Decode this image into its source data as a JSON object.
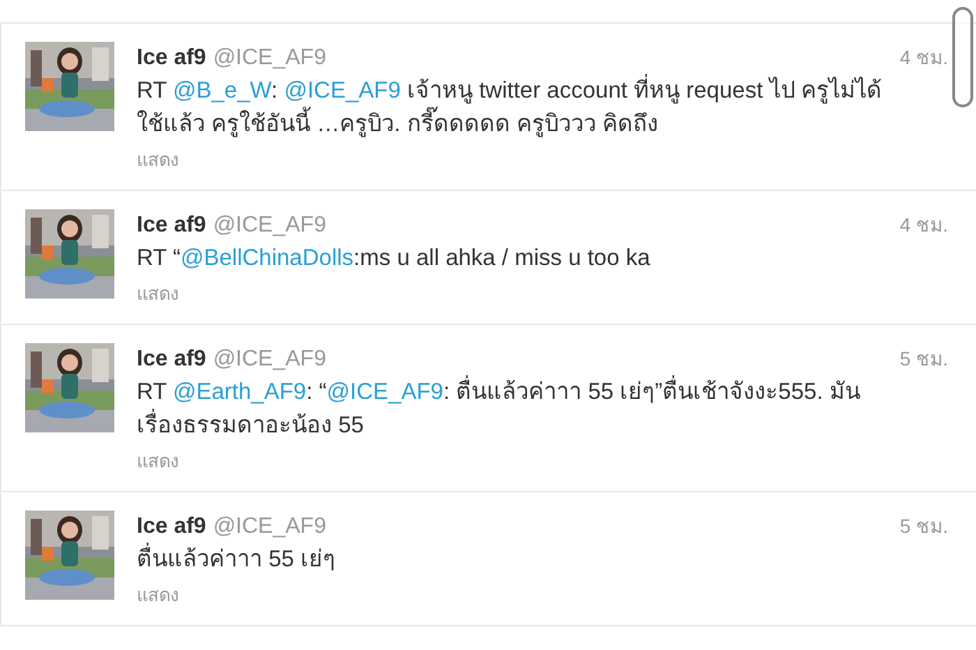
{
  "tweets": [
    {
      "name": "Ice af9",
      "handle": "@ICE_AF9",
      "time": "4 ชม.",
      "avatar": {
        "kind": "picture"
      },
      "action": "แสดง",
      "text": [
        {
          "kind": "plain",
          "text": "RT "
        },
        {
          "kind": "mention",
          "text": "@B_e_W"
        },
        {
          "kind": "plain",
          "text": ": "
        },
        {
          "kind": "mention",
          "text": "@ICE_AF9"
        },
        {
          "kind": "plain",
          "text": " เจ้าหนู twitter account ที่หนู request ไป ครูไม่ได้ใช้แล้ว ครูใช้อันนี้ …ครูบิว. กรี๊ดดดดด ครูบิววว คิดถึง"
        }
      ]
    },
    {
      "name": "Ice af9",
      "handle": "@ICE_AF9",
      "time": "4 ชม.",
      "avatar": {
        "kind": "picture"
      },
      "action": "แสดง",
      "text": [
        {
          "kind": "plain",
          "text": "RT “"
        },
        {
          "kind": "mention",
          "text": "@BellChinaDolls"
        },
        {
          "kind": "plain",
          "text": ":ms u all ahka / miss u too ka"
        }
      ]
    },
    {
      "name": "Ice af9",
      "handle": "@ICE_AF9",
      "time": "5 ชม.",
      "avatar": {
        "kind": "picture"
      },
      "action": "แสดง",
      "text": [
        {
          "kind": "plain",
          "text": "RT "
        },
        {
          "kind": "mention",
          "text": "@Earth_AF9"
        },
        {
          "kind": "plain",
          "text": ": “"
        },
        {
          "kind": "mention",
          "text": "@ICE_AF9"
        },
        {
          "kind": "plain",
          "text": ": ตื่นแล้วค่าาา 55 เย่ๆ”ตื่นเช้าจังงะ555. มันเรื่องธรรมดาอะน้อง 55"
        }
      ]
    },
    {
      "name": "Ice af9",
      "handle": "@ICE_AF9",
      "time": "5 ชม.",
      "avatar": {
        "kind": "picture"
      },
      "action": "แสดง",
      "text": [
        {
          "kind": "plain",
          "text": "ตื่นแล้วค่าาา 55 เย่ๆ"
        }
      ]
    }
  ]
}
